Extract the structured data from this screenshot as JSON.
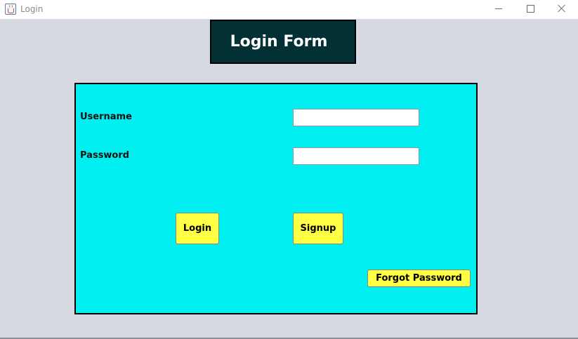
{
  "window": {
    "title": "Login",
    "icon": "java-cup-icon",
    "controls": {
      "minimize_icon": "minimize-icon",
      "maximize_icon": "maximize-icon",
      "close_icon": "close-icon"
    }
  },
  "header": {
    "title": "Login Form"
  },
  "form": {
    "username_label": "Username",
    "username_value": "",
    "password_label": "Password",
    "password_value": "",
    "login_button": "Login",
    "signup_button": "Signup",
    "forgot_button": "Forgot Password"
  },
  "colors": {
    "content_background": "#d6d9e1",
    "header_background": "#033034",
    "header_text": "#ffffff",
    "form_background": "#00eff0",
    "button_background": "#ffff44"
  }
}
